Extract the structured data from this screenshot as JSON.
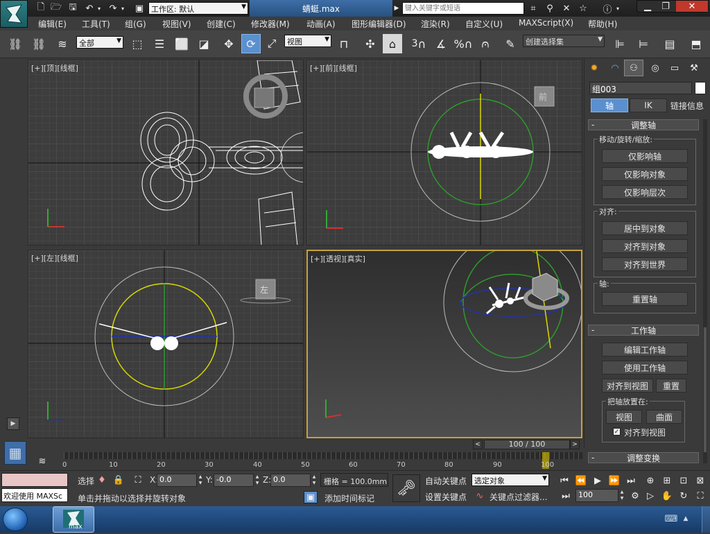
{
  "title_bar": {
    "workspace_label": "工作区: 默认",
    "file_name": "蜻蜓.max",
    "search_placeholder": "键入关键字或短语",
    "help_icon": "question-icon"
  },
  "menu": [
    "编辑(E)",
    "工具(T)",
    "组(G)",
    "视图(V)",
    "创建(C)",
    "修改器(M)",
    "动画(A)",
    "图形编辑器(D)",
    "渲染(R)",
    "自定义(U)",
    "MAXScript(X)",
    "帮助(H)"
  ],
  "toolbar": {
    "filter_select": "全部",
    "coord_select": "视图",
    "spinner_snap": "3",
    "percent_snap": "%",
    "named_selection": "创建选择集"
  },
  "viewports": {
    "top": "[+][顶][线框]",
    "front": "[+][前][线框]",
    "left": "[+][左][线框]",
    "perspective": "[+][透视][真实]",
    "left_cube": "左",
    "front_cube": "前"
  },
  "command_panel": {
    "object_name": "组003",
    "tabs": [
      "轴",
      "IK",
      "链接信息"
    ],
    "adjust_pivot": {
      "title": "调整轴",
      "move_label": "移动/旋转/缩放:",
      "buttons": [
        "仅影响轴",
        "仅影响对象",
        "仅影响层次"
      ],
      "align_label": "对齐:",
      "align_buttons": [
        "居中到对象",
        "对齐到对象",
        "对齐到世界"
      ],
      "pivot_label": "轴:",
      "reset_pivot": "重置轴"
    },
    "working_pivot": {
      "title": "工作轴",
      "edit": "编辑工作轴",
      "use": "使用工作轴",
      "align_view": "对齐到视图",
      "reset": "重置",
      "place_label": "把轴放置在:",
      "view": "视图",
      "surface": "曲面",
      "align_to_view_check": "对齐到视图"
    },
    "adjust_transform": "调整变换"
  },
  "timeline": {
    "frame_indicator": "100 / 100",
    "ticks": [
      "0",
      "10",
      "20",
      "30",
      "40",
      "50",
      "60",
      "70",
      "80",
      "90",
      "100"
    ]
  },
  "status": {
    "welcome": "欢迎使用 MAXSc",
    "selected": "选择",
    "x_label": "X:",
    "x": "0.0",
    "y_label": "Y:",
    "y": "-0.0",
    "z_label": "Z:",
    "z": "0.0",
    "grid": "栅格 = 100.0mm",
    "prompt": "单击并拖动以选择并旋转对象",
    "add_time_tag": "添加时间标记",
    "auto_key": "自动关键点",
    "set_key": "设置关键点",
    "key_mode_select": "选定对象",
    "key_filters": "关键点过滤器...",
    "current_frame": "100"
  },
  "taskbar": {
    "max_label": "max"
  },
  "colors": {
    "selection_blue": "#5b90d0",
    "timeline_accent": "#c8b400",
    "perspective_border": "#c8a03c"
  }
}
